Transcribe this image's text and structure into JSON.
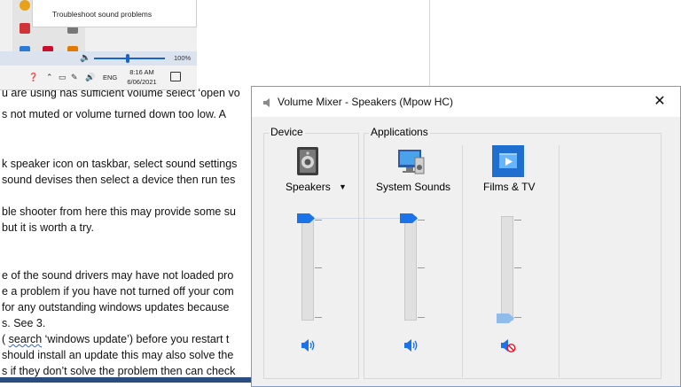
{
  "document": {
    "lines": [
      "u are using has sufficient volume select ‘open vo",
      "s not muted or volume turned down too low. A",
      "k speaker icon on taskbar, select sound settings",
      "sound devises then select a device then run tes",
      "ble shooter from here this may provide some su",
      " but it is worth a try.",
      "e of the sound drivers may have not loaded pro",
      "e a problem if you have not turned off your com",
      " for any outstanding windows updates because",
      "s. See 3.",
      " ( search ‘windows update’) before you restart t",
      " should install an update this may also solve the",
      "s if they don’t solve the problem then can check"
    ]
  },
  "taskbar_screenshot": {
    "menu_item": "Troubleshoot sound problems",
    "volume_percent_label": "100%",
    "volume_fraction": 1.0,
    "language": "ENG",
    "time": "8:16 AM",
    "date": "6/06/2021"
  },
  "mixer": {
    "title": "Volume Mixer - Speakers (Mpow HC)",
    "close_symbol": "✕",
    "device_group_label": "Device",
    "applications_group_label": "Applications",
    "device": {
      "label": "Speakers",
      "icon": "speaker-device-icon",
      "volume": 1.0,
      "muted": false
    },
    "apps": [
      {
        "label": "System Sounds",
        "icon": "system-sounds-icon",
        "volume": 1.0,
        "muted": false
      },
      {
        "label": "Films & TV",
        "icon": "films-tv-icon",
        "volume": 0.0,
        "muted": true
      }
    ],
    "colors": {
      "accent": "#1a73e8",
      "muted_red": "#e81123"
    }
  }
}
